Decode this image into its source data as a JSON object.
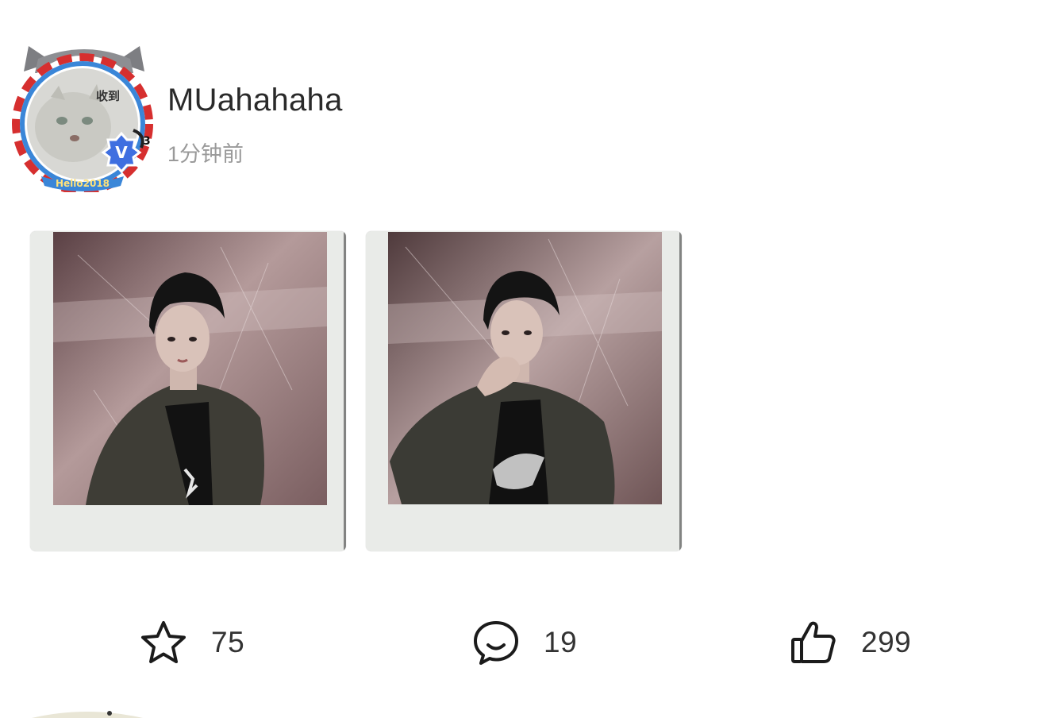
{
  "post": {
    "author": {
      "name": "MUahahaha",
      "avatar_sticker_text": "收到",
      "frame_text": "Hello2018",
      "verified_badge": "V",
      "badge_level": "3"
    },
    "time": "1分钟前",
    "images": [
      {
        "name": "polaroid-photo-1"
      },
      {
        "name": "polaroid-photo-2"
      }
    ]
  },
  "actions": {
    "repost": {
      "icon": "star-icon",
      "count": "75"
    },
    "comment": {
      "icon": "comment-icon",
      "count": "19"
    },
    "like": {
      "icon": "thumbs-up-icon",
      "count": "299"
    }
  },
  "colors": {
    "text_primary": "#2a2a2a",
    "text_secondary": "#9a9a9a",
    "verified_blue": "#3f6fe0",
    "frame_grey": "#e9ebe8"
  }
}
